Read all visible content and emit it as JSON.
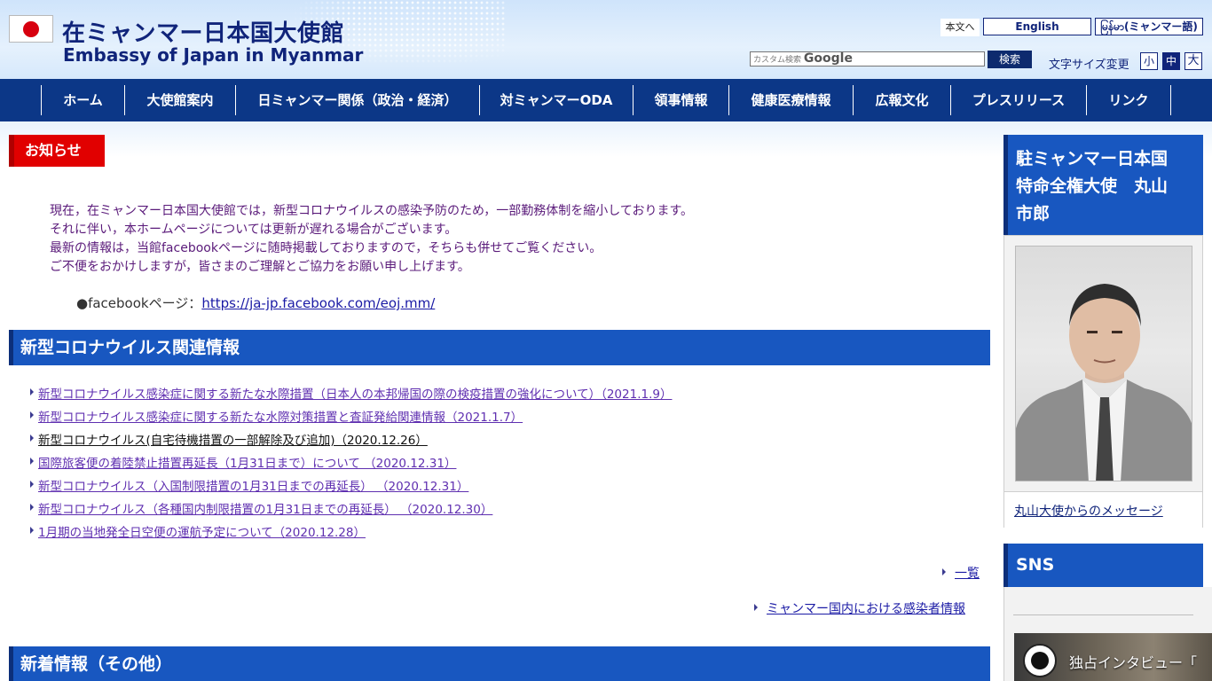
{
  "header": {
    "title_jp": "在ミャンマー日本国大使館",
    "title_en": "Embassy of Japan in Myanmar",
    "skip_link": "本文へ",
    "lang_english": "English",
    "lang_myanmar": " မြန်မာ(ミャンマー語)",
    "search_placeholder": "カスタム検索",
    "search_brand": "Google",
    "search_button": "検索",
    "font_size_label": "文字サイズ変更",
    "font_small": "小",
    "font_medium": "中",
    "font_large": "大"
  },
  "nav": [
    {
      "label": "ホーム"
    },
    {
      "label": "大使館案内"
    },
    {
      "label": "日ミャンマー関係（政治・経済）"
    },
    {
      "label": "対ミャンマーODA"
    },
    {
      "label": "領事情報"
    },
    {
      "label": "健康医療情報"
    },
    {
      "label": "広報文化"
    },
    {
      "label": "プレスリリース"
    },
    {
      "label": "リンク"
    }
  ],
  "notice": {
    "tag": "お知らせ",
    "lines": [
      "現在，在ミャンマー日本国大使館では，新型コロナウイルスの感染予防のため，一部勤務体制を縮小しております。",
      "それに伴い，本ホームページについては更新が遅れる場合がございます。",
      "最新の情報は，当館facebookページに随時掲載しておりますので，そちらも併せてご覧ください。",
      "ご不便をおかけしますが，皆さまのご理解とご協力をお願い申し上げます。"
    ],
    "fb_label": "●facebookページ：",
    "fb_url": "https://ja-jp.facebook.com/eoj.mm/"
  },
  "covid": {
    "heading": "新型コロナウイルス関連情報",
    "items": [
      "新型コロナウイルス感染症に関する新たな水際措置（日本人の本邦帰国の際の検疫措置の強化について）（2021.1.9）",
      "新型コロナウイルス感染症に関する新たな水際対策措置と査証発給関連情報（2021.1.7）",
      "新型コロナウイルス(自宅待機措置の一部解除及び追加)（2020.12.26）",
      "国際旅客便の着陸禁止措置再延長（1月31日まで）について （2020.12.31）",
      "新型コロナウイルス（入国制限措置の1月31日までの再延長） （2020.12.31）",
      "新型コロナウイルス（各種国内制限措置の1月31日までの再延長） （2020.12.30）",
      "1月期の当地発全日空便の運航予定について（2020.12.28）"
    ],
    "more_all": "一覧",
    "more_cases": "ミャンマー国内における感染者情報"
  },
  "news": {
    "heading": "新着情報（その他）"
  },
  "sidebar": {
    "ambassador_heading_lines": [
      "駐ミャンマー日本国",
      "特命全権大使　丸山",
      "市郎"
    ],
    "ambassador_link": "丸山大使からのメッセージ",
    "sns_heading": "SNS",
    "video_title": "独占インタビュー「"
  },
  "colors": {
    "nav_bg": "#0c3787",
    "section_blue": "#1857c0",
    "notice_red": "#e10000",
    "title_navy": "#10247a"
  }
}
